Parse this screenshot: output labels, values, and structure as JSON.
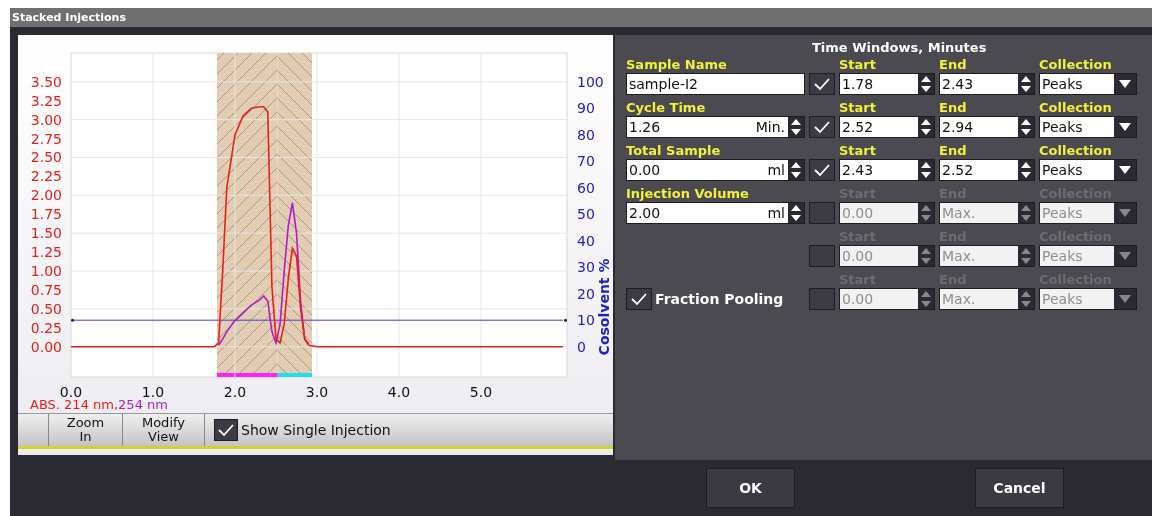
{
  "window": {
    "title": "Stacked Injections"
  },
  "chart": {
    "chart_data": {
      "type": "line",
      "x": [
        0,
        0.5,
        1,
        1.5,
        1.75,
        1.8,
        1.85,
        1.9,
        2.0,
        2.1,
        2.2,
        2.3,
        2.35,
        2.4,
        2.45,
        2.5,
        2.55,
        2.6,
        2.65,
        2.7,
        2.75,
        2.8,
        2.85,
        2.9,
        3.0,
        4,
        5,
        6
      ],
      "series": [
        {
          "color": "#e8201c",
          "values": [
            0,
            0,
            0,
            0,
            0,
            0.05,
            1.0,
            2.1,
            2.8,
            3.05,
            3.15,
            3.17,
            3.17,
            3.1,
            0.8,
            0.1,
            0.05,
            0.3,
            0.9,
            1.3,
            1.2,
            0.5,
            0.1,
            0.02,
            0,
            0,
            0,
            0
          ]
        },
        {
          "color": "#b01cc8",
          "values": [
            null,
            null,
            null,
            null,
            null,
            0.02,
            0.1,
            0.2,
            0.35,
            0.45,
            0.55,
            0.62,
            0.67,
            0.6,
            0.2,
            0.05,
            0.3,
            1.0,
            1.6,
            1.9,
            1.5,
            0.6,
            0.1,
            0.04,
            null,
            null,
            null,
            null
          ]
        },
        {
          "color": "#4040d0",
          "axis": "y2",
          "values": [
            10,
            10,
            10,
            10,
            10,
            10,
            10,
            10,
            10,
            10,
            10,
            10,
            10,
            10,
            10,
            10,
            10,
            10,
            10,
            10,
            10,
            10,
            10,
            10,
            10,
            10,
            10,
            10
          ]
        }
      ],
      "grid": true,
      "xlim": [
        0,
        6.05
      ],
      "ylim": [
        -0.4,
        3.88
      ],
      "xticks": [
        {
          "value": 0,
          "label": "0.0"
        },
        {
          "value": 1,
          "label": "1.0"
        },
        {
          "value": 2,
          "label": "2.0"
        },
        {
          "value": 3,
          "label": "3.0"
        },
        {
          "value": 4,
          "label": "4.0"
        },
        {
          "value": 5,
          "label": "5.0"
        }
      ],
      "yticks": [
        {
          "value": 0,
          "label": "0.00"
        },
        {
          "value": 0.25,
          "label": "0.25"
        },
        {
          "value": 0.5,
          "label": "0.50"
        },
        {
          "value": 0.75,
          "label": "0.75"
        },
        {
          "value": 1,
          "label": "1.00"
        },
        {
          "value": 1.25,
          "label": "1.25"
        },
        {
          "value": 1.5,
          "label": "1.50"
        },
        {
          "value": 1.75,
          "label": "1.75"
        },
        {
          "value": 2,
          "label": "2.00"
        },
        {
          "value": 2.25,
          "label": "2.25"
        },
        {
          "value": 2.5,
          "label": "2.50"
        },
        {
          "value": 2.75,
          "label": "2.75"
        },
        {
          "value": 3,
          "label": "3.00"
        },
        {
          "value": 3.25,
          "label": "3.25"
        },
        {
          "value": 3.5,
          "label": "3.50"
        }
      ],
      "y2label": "Cosolvent %",
      "y2lim": [
        -11.43,
        110.86
      ],
      "y2ticks": [
        {
          "value": 0,
          "label": "0"
        },
        {
          "value": 10,
          "label": "10"
        },
        {
          "value": 20,
          "label": "20"
        },
        {
          "value": 30,
          "label": "30"
        },
        {
          "value": 40,
          "label": "40"
        },
        {
          "value": 50,
          "label": "50"
        },
        {
          "value": 60,
          "label": "60"
        },
        {
          "value": 70,
          "label": "70"
        },
        {
          "value": 80,
          "label": "80"
        },
        {
          "value": 90,
          "label": "90"
        },
        {
          "value": 100,
          "label": "100"
        }
      ]
    },
    "abs_label": [
      {
        "text": "ABS. 214 nm,",
        "color": "#e8201c"
      },
      {
        "text": "254 nm",
        "color": "#b01cc8"
      }
    ]
  },
  "toolbar": {
    "buttons": [
      {
        "label": "Zoom In"
      },
      {
        "label": "Modify View"
      }
    ],
    "show_single_injection": {
      "label": "Show Single Injection",
      "checked": true
    }
  },
  "settings": {
    "fields": [
      {
        "label": "Sample Name",
        "value": "sample-I2",
        "kind": "text"
      },
      {
        "label": "Cycle Time",
        "value": "1.26",
        "unit": "Min.",
        "kind": "spin"
      },
      {
        "label": "Total Sample",
        "value": "0.00",
        "unit": "ml",
        "kind": "spin"
      },
      {
        "label": "Injection Volume",
        "value": "2.00",
        "unit": "ml",
        "kind": "spin"
      }
    ],
    "fraction_pooling": {
      "label": "Fraction Pooling",
      "checked": true
    }
  },
  "time_windows": {
    "title": "Time Windows, Minutes",
    "rows": [
      {
        "enabled": true,
        "start_label": "Start",
        "start": "1.78",
        "end_label": "End",
        "end": "2.43",
        "collection_label": "Collection",
        "collection": "Peaks",
        "color": "#ff20f0"
      },
      {
        "enabled": true,
        "start_label": "Start",
        "start": "2.52",
        "end_label": "End",
        "end": "2.94",
        "collection_label": "Collection",
        "collection": "Peaks",
        "color": "#20e0f0"
      },
      {
        "enabled": true,
        "start_label": "Start",
        "start": "2.43",
        "end_label": "End",
        "end": "2.52",
        "collection_label": "Collection",
        "collection": "Peaks",
        "color": "#ff20f0"
      },
      {
        "enabled": false,
        "start_label": "Start",
        "start": "0.00",
        "end_label": "End",
        "end": "Max.",
        "collection_label": "Collection",
        "collection": "Peaks"
      },
      {
        "enabled": false,
        "start_label": "Start",
        "start": "0.00",
        "end_label": "End",
        "end": "Max.",
        "collection_label": "Collection",
        "collection": "Peaks"
      },
      {
        "enabled": false,
        "start_label": "Start",
        "start": "0.00",
        "end_label": "End",
        "end": "Max.",
        "collection_label": "Collection",
        "collection": "Peaks"
      }
    ]
  },
  "buttons": [
    {
      "label": "OK"
    },
    {
      "label": "Cancel"
    }
  ]
}
